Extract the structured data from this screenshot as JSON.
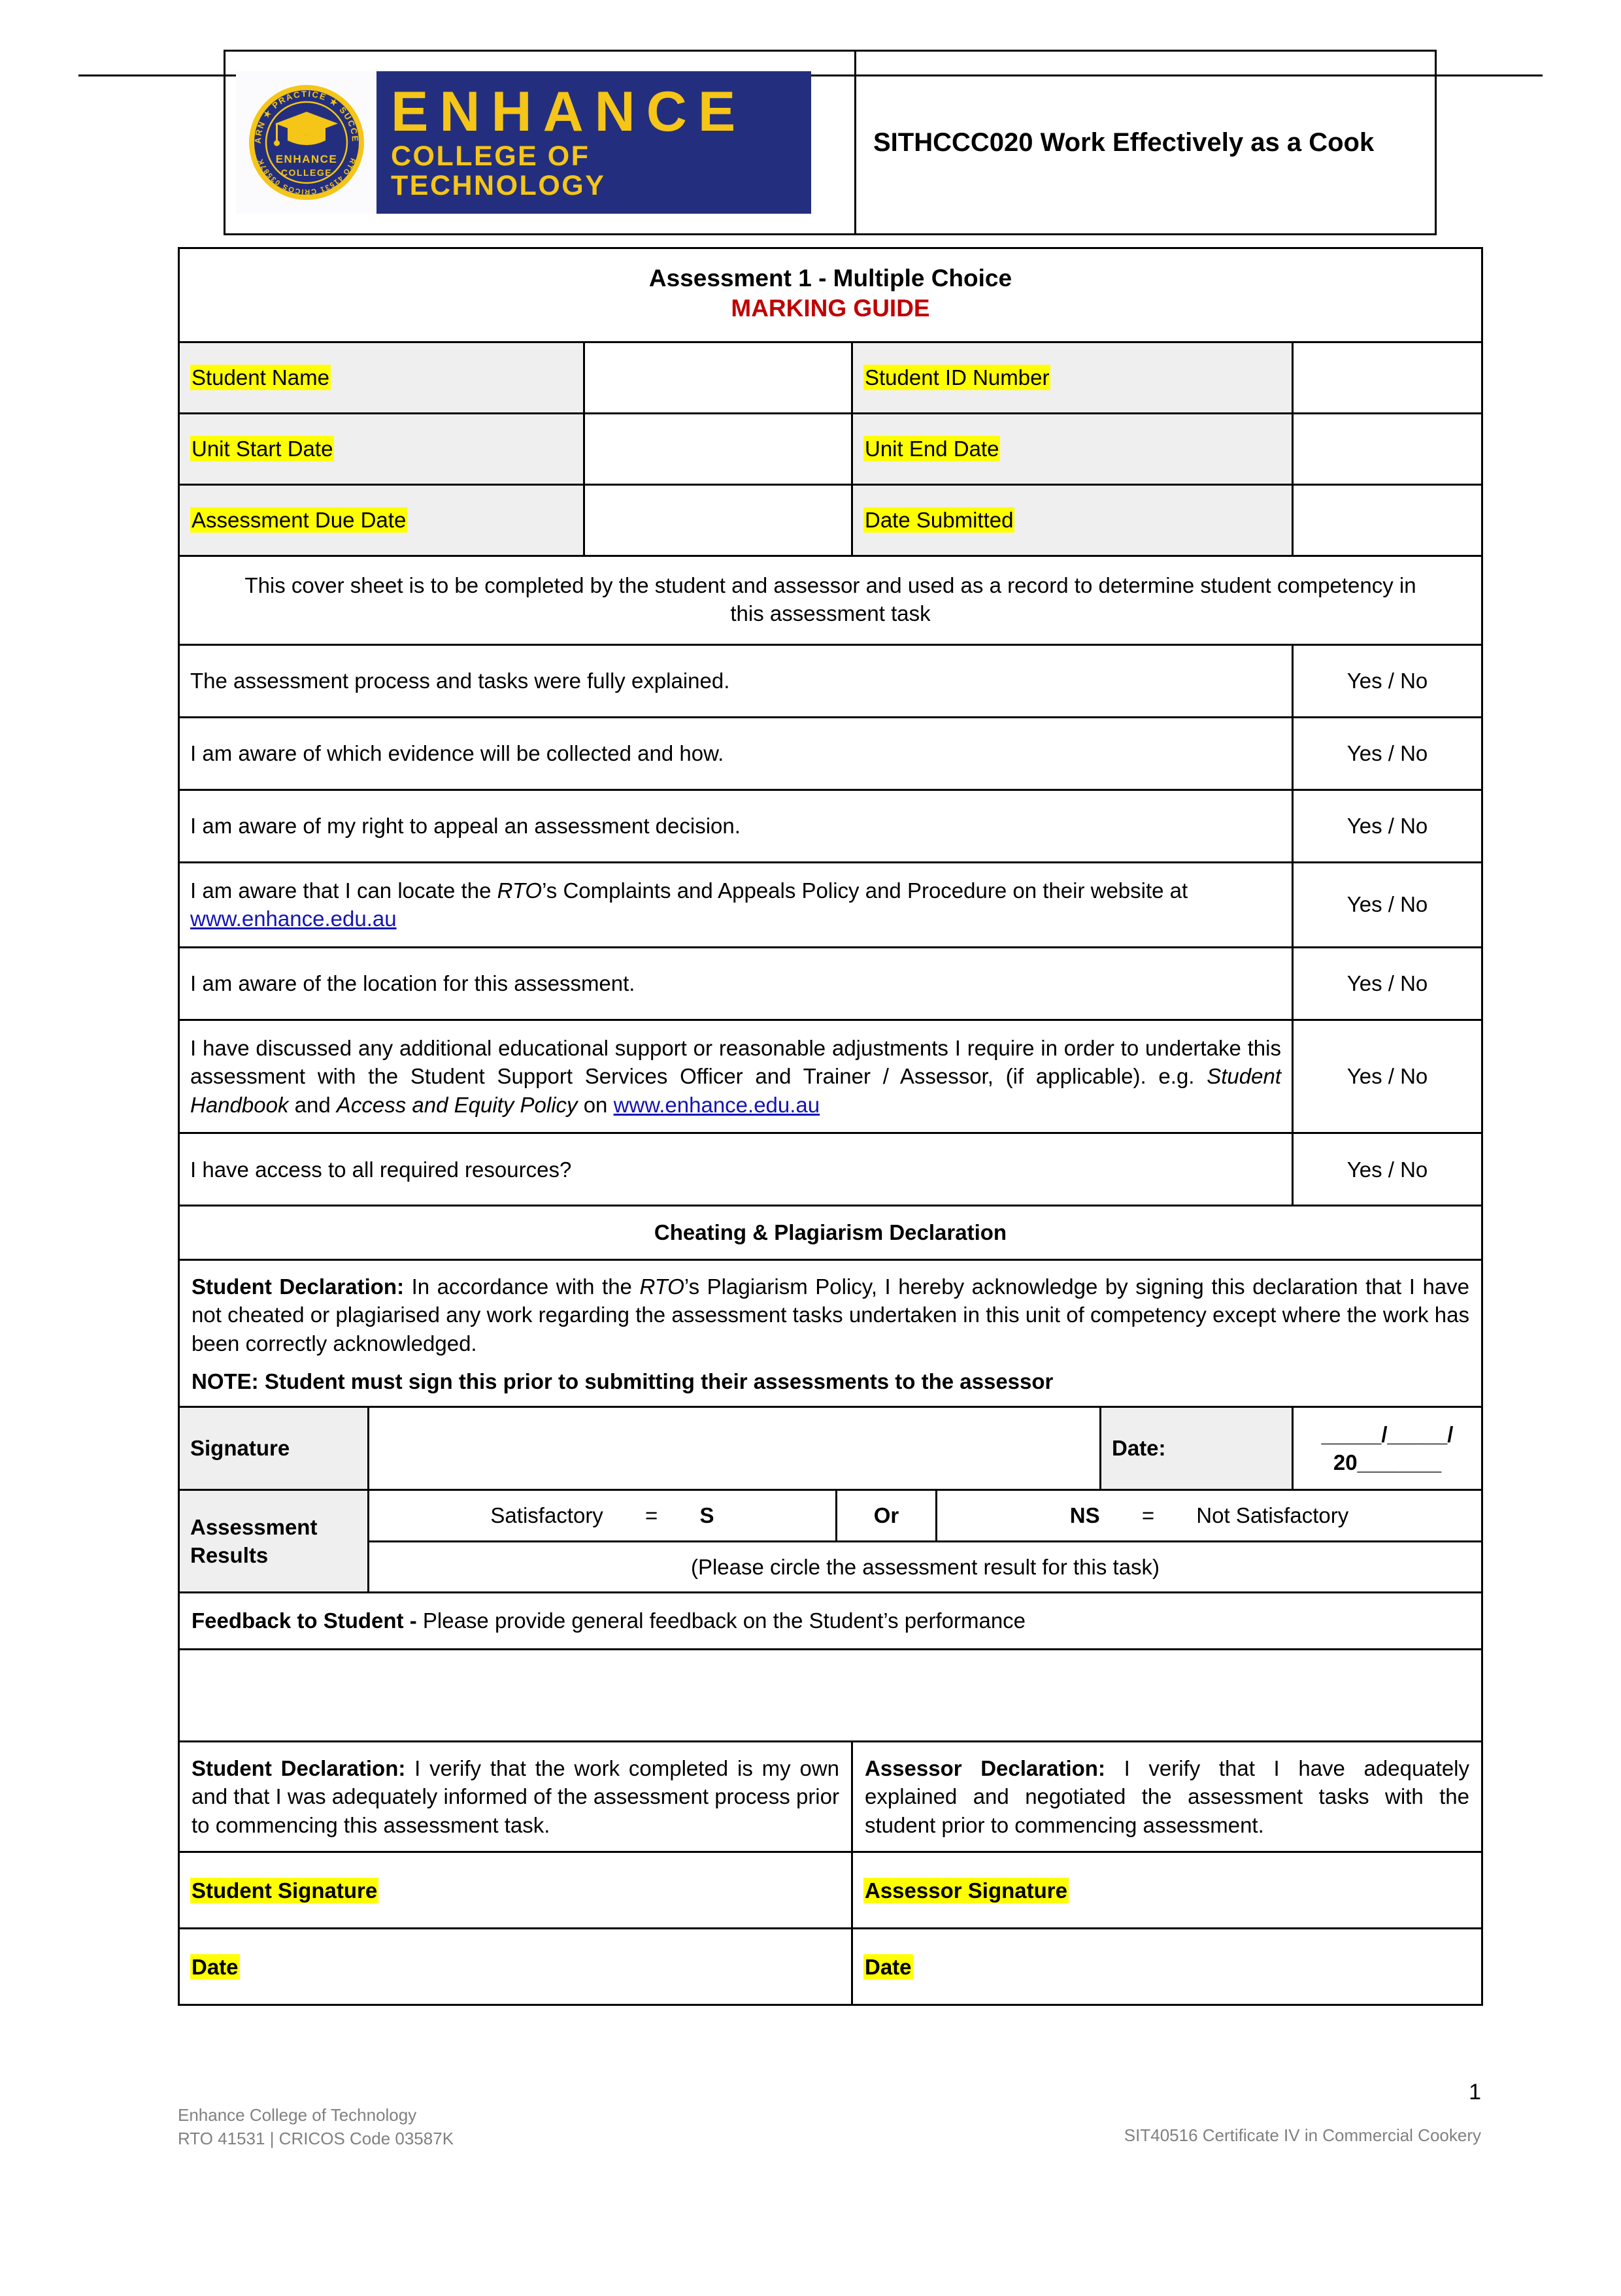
{
  "header": {
    "logo": {
      "brand": "ENHANCE",
      "tagline": "COLLEGE OF TECHNOLOGY",
      "badge_name": "ENHANCE",
      "badge_name2": "COLLEGE",
      "badge_ring_top": "PRACTICE",
      "badge_ring_left": "LEARN",
      "badge_ring_right": "SUCCEED",
      "badge_ring_bottom": "RTO 41531 CRICOS 03587K",
      "navy": "#232f7e",
      "gold": "#f5c518"
    },
    "unit_title": "SITHCCC020 Work Effectively as a Cook"
  },
  "title": {
    "line1": "Assessment 1 - Multiple Choice",
    "line2": "MARKING GUIDE",
    "line2_color": "#c00000"
  },
  "student_info": [
    {
      "label_left": "Student Name",
      "value_left": "",
      "label_right": "Student ID Number",
      "value_right": ""
    },
    {
      "label_left": "Unit Start Date",
      "value_left": "",
      "label_right": "Unit End Date",
      "value_right": ""
    },
    {
      "label_left": "Assessment Due Date",
      "value_left": "",
      "label_right": "Date Submitted",
      "value_right": ""
    }
  ],
  "coversheet_note": "This cover sheet is to be completed by the student and assessor and used as a record to determine student competency in this assessment task",
  "checklist": {
    "answer_label": "Yes / No",
    "items": [
      {
        "text": "The assessment process and tasks were fully explained."
      },
      {
        "text": "I am aware of which evidence will be collected and how."
      },
      {
        "text": "I am aware of my right to appeal an assessment decision."
      },
      {
        "pre": "I am aware that I can locate the ",
        "italic": "RTO",
        "mid": "’s Complaints and Appeals Policy and Procedure on their website at ",
        "link": "www.enhance.edu.au"
      },
      {
        "text": "I am aware of the location for this assessment."
      },
      {
        "pre": "I have discussed any additional educational support or reasonable adjustments I require in order to undertake this assessment with the Student Support Services Officer and Trainer / Assessor, (if applicable). e.g. ",
        "italic1": "Student Handbook",
        "mid": " and ",
        "italic2": "Access and Equity Policy",
        "post": " on ",
        "link": "www.enhance.edu.au"
      },
      {
        "text": "I have access to all required resources?"
      }
    ]
  },
  "plagiarism": {
    "heading": "Cheating & Plagiarism Declaration",
    "decl_bold": "Student Declaration:",
    "decl_pre": " In accordance with the ",
    "decl_italic": "RTO",
    "decl_post": "’s Plagiarism Policy, I hereby acknowledge by signing this declaration that I have not cheated or plagiarised any work regarding the assessment tasks undertaken in this unit of competency except where the work has been correctly acknowledged.",
    "note": "NOTE: Student must sign this prior to submitting their assessments to the assessor"
  },
  "signature_row": {
    "label": "Signature",
    "value": "",
    "date_label": "Date:",
    "date_line": "_____/_____/ 20_______"
  },
  "results": {
    "label": "Assessment Results",
    "satisfactory_word": "Satisfactory",
    "equals1": "=",
    "s_code": "S",
    "or_word": "Or",
    "ns_code": "NS",
    "equals2": "=",
    "not_satisfactory_word": "Not Satisfactory",
    "instruction": "(Please circle the assessment result for this task)"
  },
  "feedback": {
    "label_bold": "Feedback to Student - ",
    "label_rest": "Please provide general feedback on the Student’s performance",
    "value": ""
  },
  "final_declarations": {
    "student": {
      "bold": "Student Declaration:",
      "text": " I verify that the work completed is my own and that I was adequately informed of the assessment process prior to commencing this assessment task."
    },
    "assessor": {
      "bold": "Assessor Declaration:",
      "text": " I verify that I have adequately explained and negotiated the assessment tasks with the student prior to commencing assessment."
    },
    "student_signature_label": "Student Signature",
    "assessor_signature_label": "Assessor Signature",
    "student_date_label": "Date",
    "assessor_date_label": "Date",
    "student_signature_value": "",
    "assessor_signature_value": "",
    "student_date_value": "",
    "assessor_date_value": ""
  },
  "footer": {
    "org": "Enhance College of Technology",
    "rto": "RTO 41531 | CRICOS Code 03587K",
    "qualification": "SIT40516 Certificate IV in Commercial Cookery",
    "page_number": "1"
  }
}
